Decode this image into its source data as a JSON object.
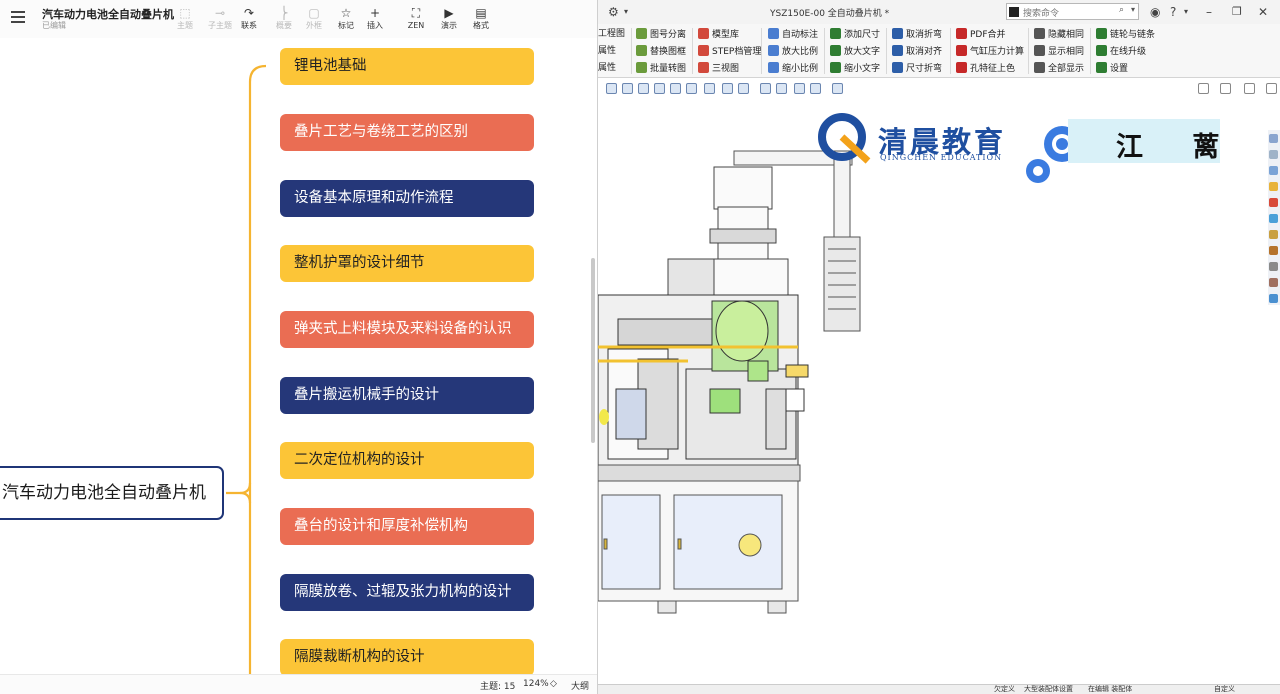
{
  "mindmap": {
    "title": "汽车动力电池全自动叠片机",
    "subtitle": "已编辑",
    "toolbar": [
      {
        "label": "主题",
        "icon": "topic-icon",
        "glyph": "⬚",
        "disabled": true
      },
      {
        "label": "子主题",
        "icon": "subtopic-icon",
        "glyph": "⊸",
        "disabled": true
      },
      {
        "label": "联系",
        "icon": "relationship-icon",
        "glyph": "↷",
        "disabled": false
      },
      {
        "label": "概要",
        "icon": "summary-icon",
        "glyph": "⎬",
        "disabled": true
      },
      {
        "label": "外框",
        "icon": "boundary-icon",
        "glyph": "▢",
        "disabled": true
      },
      {
        "label": "标记",
        "icon": "marker-icon",
        "glyph": "☆",
        "disabled": false
      },
      {
        "label": "插入",
        "icon": "insert-icon",
        "glyph": "+",
        "disabled": false
      },
      {
        "label": "ZEN",
        "icon": "zen-icon",
        "glyph": "⛶",
        "disabled": false
      },
      {
        "label": "演示",
        "icon": "present-icon",
        "glyph": "▶",
        "disabled": false
      },
      {
        "label": "格式",
        "icon": "format-icon",
        "glyph": "▤",
        "disabled": false
      }
    ],
    "central_topic": "汽车动力电池全自动叠片机",
    "topics": [
      {
        "label": "锂电池基础",
        "color": "yellow"
      },
      {
        "label": "叠片工艺与卷绕工艺的区别",
        "color": "red"
      },
      {
        "label": "设备基本原理和动作流程",
        "color": "navy"
      },
      {
        "label": "整机护罩的设计细节",
        "color": "yellow"
      },
      {
        "label": "弹夹式上料模块及来料设备的认识",
        "color": "red"
      },
      {
        "label": "叠片搬运机械手的设计",
        "color": "navy"
      },
      {
        "label": "二次定位机构的设计",
        "color": "yellow"
      },
      {
        "label": "叠台的设计和厚度补偿机构",
        "color": "red"
      },
      {
        "label": "隔膜放卷、过辊及张力机构的设计",
        "color": "navy"
      },
      {
        "label": "隔膜裁断机构的设计",
        "color": "yellow"
      }
    ],
    "status": {
      "topic_count": "主题: 15",
      "zoom": "124%",
      "outline": "大纲"
    },
    "colors": {
      "yellow": "#fcc537",
      "red": "#ea6d53",
      "navy": "#253779",
      "branch": "#f5b431"
    }
  },
  "cad": {
    "document_title": "YSZ150E-00 全自动叠片机 *",
    "search_placeholder": "搜索命令",
    "ribbon": {
      "col0": [
        "工程图",
        "属性",
        "属性"
      ],
      "col1": [
        "图号分离",
        "替换图框",
        "批量转图"
      ],
      "col2": [
        "模型库",
        "STEP档管理",
        "三视图"
      ],
      "col3": [
        "自动标注",
        "放大比例",
        "缩小比例"
      ],
      "col4": [
        "添加尺寸",
        "放大文字",
        "缩小文字"
      ],
      "col5": [
        "取消折弯",
        "取消对齐",
        "尺寸折弯"
      ],
      "col6": [
        "PDF合并",
        "气缸压力计算",
        "孔特征上色"
      ],
      "col7": [
        "隐藏相同",
        "显示相同",
        "全部显示"
      ],
      "col8": [
        "链轮与链条",
        "在线升级",
        "设置"
      ]
    },
    "logo": {
      "chinese": "清晨教育",
      "english": "QINGCHEN EDUCATION",
      "name": "江 蓠"
    },
    "status": [
      "欠定义",
      "大型装配体设置",
      "在编辑 装配体",
      "自定义"
    ]
  }
}
